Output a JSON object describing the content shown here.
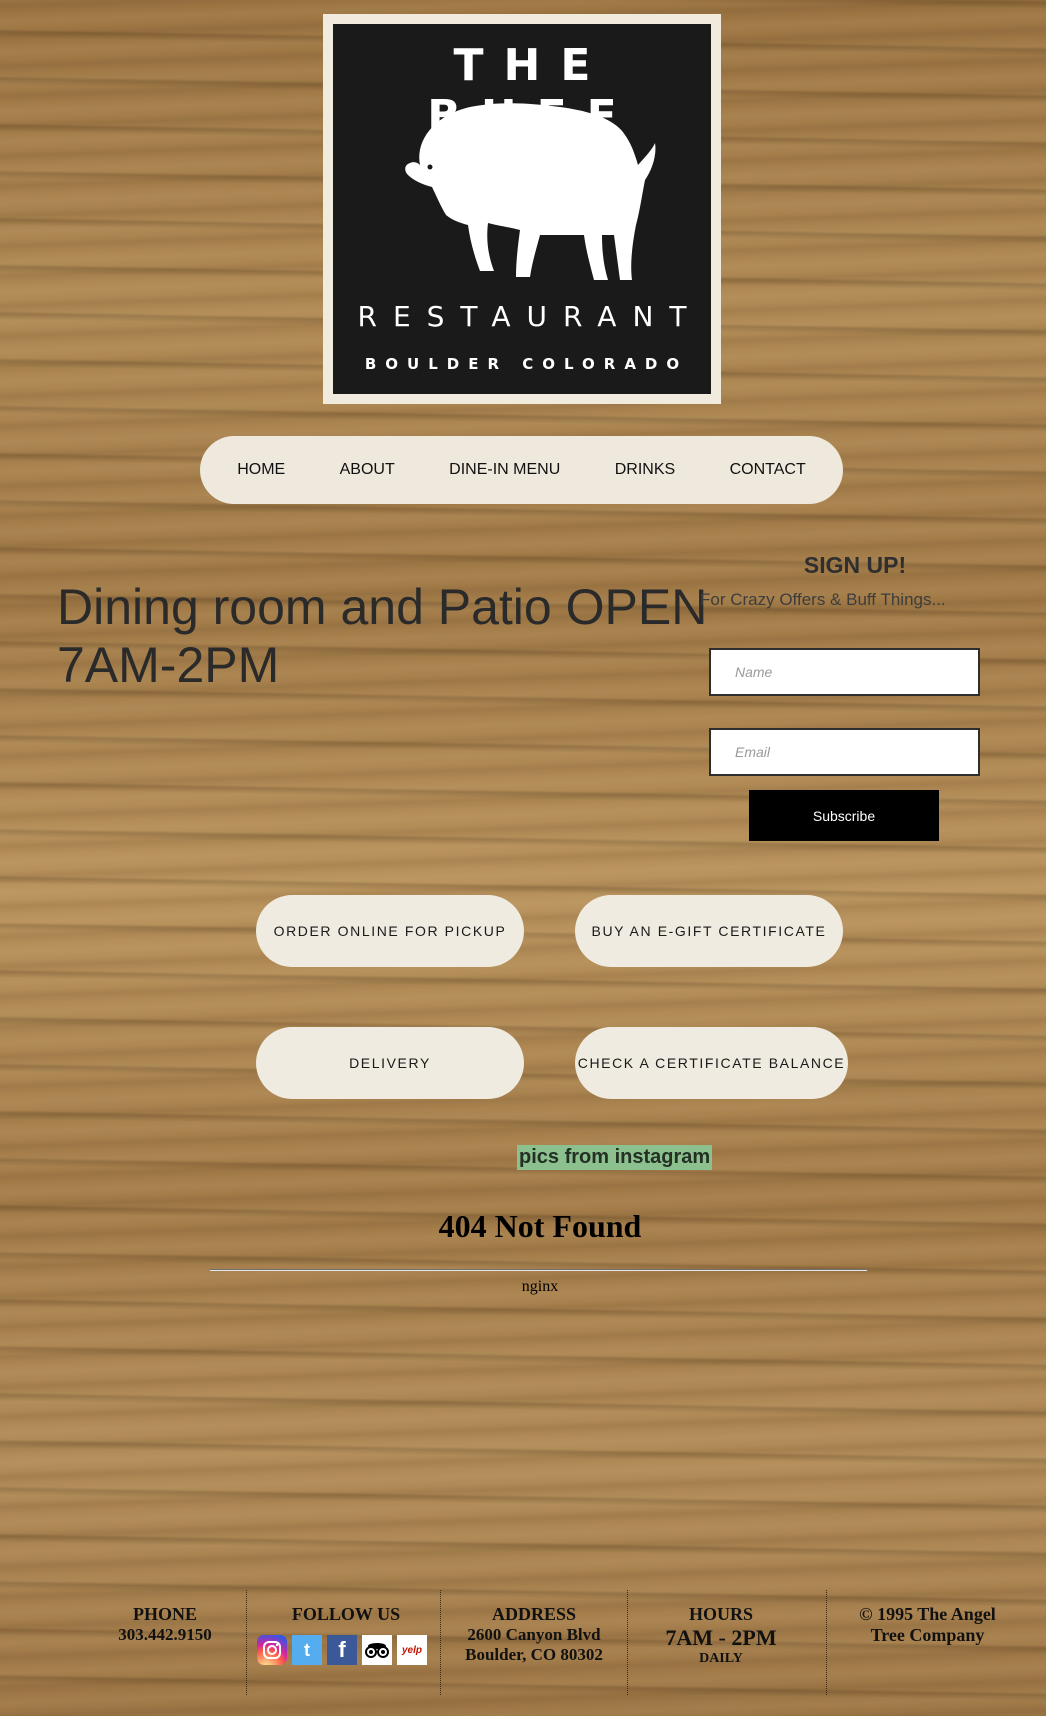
{
  "logo": {
    "line1": "THE BUFF",
    "line2": "RESTAURANT",
    "line3": "BOULDER COLORADO"
  },
  "nav": {
    "items": [
      "HOME",
      "ABOUT",
      "DINE-IN MENU",
      "DRINKS",
      "CONTACT"
    ]
  },
  "headline": {
    "line1": "Dining room and Patio OPEN",
    "line2": "7AM-2PM"
  },
  "signup": {
    "title": "SIGN UP!",
    "subtitle": "For Crazy Offers & Buff Things...",
    "name_placeholder": "Name",
    "email_placeholder": "Email",
    "button": "Subscribe"
  },
  "buttons": {
    "order": "ORDER ONLINE FOR PICKUP",
    "gift": "BUY AN E-GIFT CERTIFICATE",
    "delivery": "DELIVERY",
    "balance": "CHECK A CERTIFICATE BALANCE"
  },
  "instagram": {
    "label": "pics from instagram"
  },
  "error": {
    "title": "404 Not Found",
    "server": "nginx"
  },
  "footer": {
    "phone_label": "PHONE",
    "phone": "303.442.9150",
    "follow_label": "FOLLOW US",
    "address_label": "ADDRESS",
    "address_line1": "2600 Canyon Blvd",
    "address_line2": "Boulder, CO 80302",
    "hours_label": "HOURS",
    "hours": "7AM - 2PM",
    "hours_note": "DAILY",
    "copyright_line1": "© 1995 The Angel",
    "copyright_line2": "Tree Company",
    "social": {
      "twitter_glyph": "t",
      "facebook_glyph": "f",
      "yelp_text": "yelp"
    }
  },
  "colors": {
    "nav_bg": "#efe8dc",
    "pill_bg": "#f0ebe0",
    "subscribe_bg": "#000000",
    "instagram_highlight": "#8cc08e",
    "twitter": "#55acee",
    "facebook": "#3b5998"
  }
}
